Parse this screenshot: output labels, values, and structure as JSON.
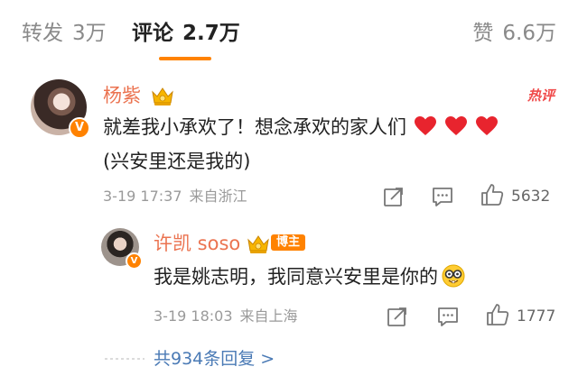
{
  "tabs": {
    "repost": {
      "label": "转发",
      "count": "3万"
    },
    "comments": {
      "label": "评论",
      "count": "2.7万"
    },
    "likes": {
      "label": "赞",
      "count": "6.6万"
    }
  },
  "colors": {
    "accent": "#ff8200",
    "username": "#eb7350",
    "hot": "#f04a4a",
    "link": "#4a7ab5",
    "heart": "#e8242e"
  },
  "comment": {
    "user": "杨紫",
    "hot_label": "热评",
    "text": "就差我小承欢了！想念承欢的家人们",
    "text_line2": "(兴安里还是我的)",
    "emoji": [
      "heart-icon",
      "heart-icon",
      "heart-icon"
    ],
    "date": "3-19 17:37",
    "location": "来自浙江",
    "like_count": "5632"
  },
  "reply": {
    "user": "许凯 soso",
    "host_badge": "博主",
    "text": "我是姚志明，我同意兴安里是你的",
    "emoji": "nerd-face-icon",
    "date": "3-19 18:03",
    "location": "来自上海",
    "like_count": "1777"
  },
  "all_replies": "共934条回复 >"
}
